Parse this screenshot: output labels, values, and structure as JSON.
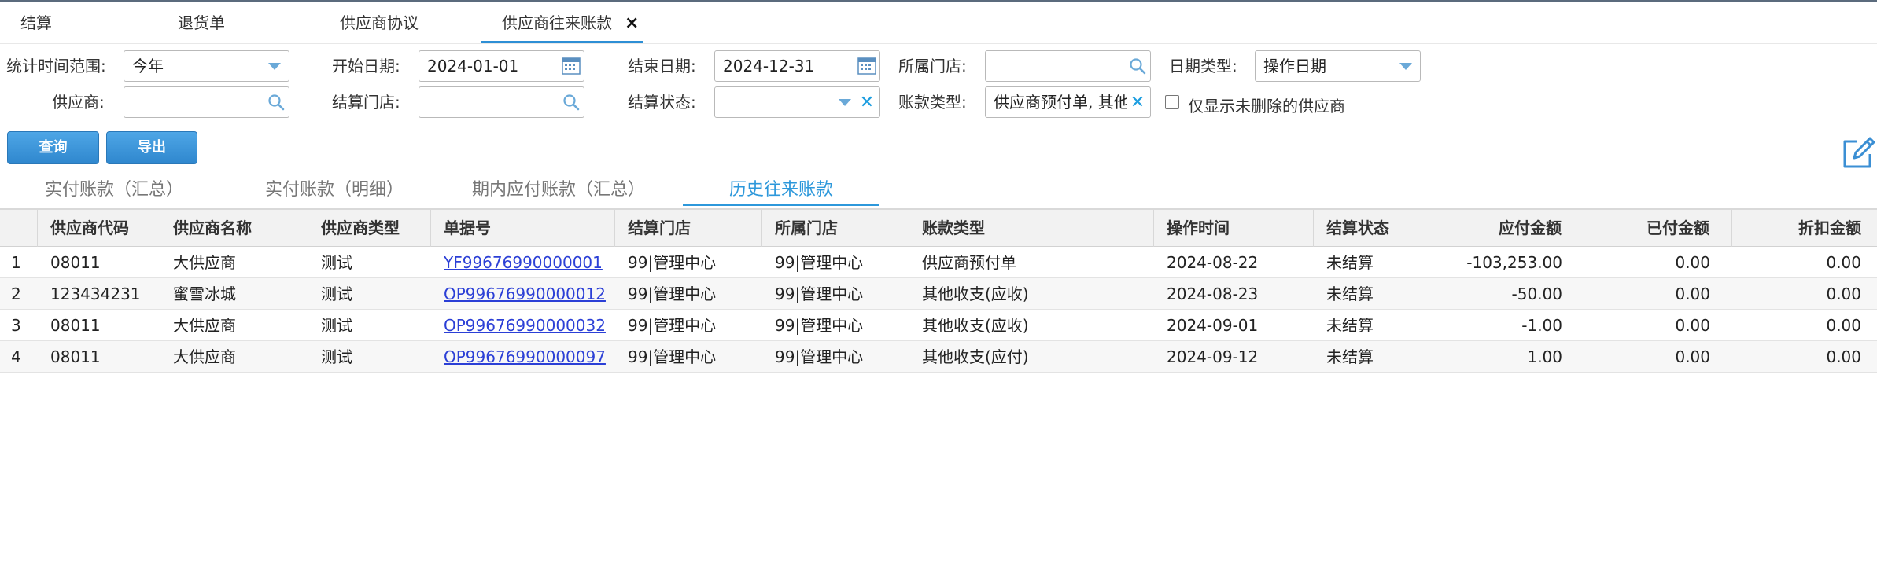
{
  "tabs": [
    {
      "label": "结算"
    },
    {
      "label": "退货单"
    },
    {
      "label": "供应商协议"
    },
    {
      "label": "供应商往来账款",
      "close": "×"
    }
  ],
  "filters": {
    "range_label": "统计时间范围:",
    "range_value": "今年",
    "start_label": "开始日期:",
    "start_value": "2024-01-01",
    "end_label": "结束日期:",
    "end_value": "2024-12-31",
    "store_label": "所属门店:",
    "store_value": "",
    "date_type_label": "日期类型:",
    "date_type_value": "操作日期",
    "supplier_label": "供应商:",
    "supplier_value": "",
    "settle_store_label": "结算门店:",
    "settle_store_value": "",
    "settle_status_label": "结算状态:",
    "settle_status_value": "",
    "account_type_label": "账款类型:",
    "account_type_value": "供应商预付单, 其他",
    "only_undeleted_label": "仅显示未删除的供应商"
  },
  "buttons": {
    "query": "查询",
    "export": "导出"
  },
  "subtabs": [
    {
      "label": "实付账款（汇总）"
    },
    {
      "label": "实付账款（明细）"
    },
    {
      "label": "期内应付账款（汇总）"
    },
    {
      "label": "历史往来账款"
    }
  ],
  "table": {
    "columns": [
      "",
      "供应商代码",
      "供应商名称",
      "供应商类型",
      "单据号",
      "结算门店",
      "所属门店",
      "账款类型",
      "操作时间",
      "结算状态",
      "应付金额",
      "已付金额",
      "折扣金额"
    ],
    "rows": [
      [
        "1",
        "08011",
        "大供应商",
        "测试",
        "YF99676990000001",
        "99|管理中心",
        "99|管理中心",
        "供应商预付单",
        "2024-08-22",
        "未结算",
        "-103,253.00",
        "0.00",
        "0.00"
      ],
      [
        "2",
        "123434231",
        "蜜雪冰城",
        "测试",
        "OP99676990000012",
        "99|管理中心",
        "99|管理中心",
        "其他收支(应收)",
        "2024-08-23",
        "未结算",
        "-50.00",
        "0.00",
        "0.00"
      ],
      [
        "3",
        "08011",
        "大供应商",
        "测试",
        "OP99676990000032",
        "99|管理中心",
        "99|管理中心",
        "其他收支(应收)",
        "2024-09-01",
        "未结算",
        "-1.00",
        "0.00",
        "0.00"
      ],
      [
        "4",
        "08011",
        "大供应商",
        "测试",
        "OP99676990000097",
        "99|管理中心",
        "99|管理中心",
        "其他收支(应付)",
        "2024-09-12",
        "未结算",
        "1.00",
        "0.00",
        "0.00"
      ]
    ]
  }
}
